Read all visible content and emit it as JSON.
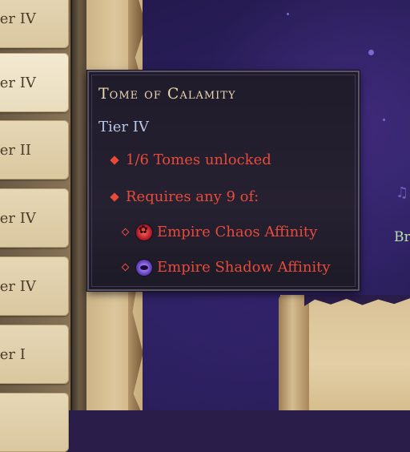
{
  "tier_list": [
    {
      "label": "Tier IV",
      "selected": false
    },
    {
      "label": "Tier IV",
      "selected": true
    },
    {
      "label": "Tier II",
      "selected": false
    },
    {
      "label": "Tier IV",
      "selected": false
    },
    {
      "label": "Tier IV",
      "selected": false
    },
    {
      "label": "Tier I",
      "selected": false
    }
  ],
  "background_text": "Br",
  "tooltip": {
    "title": "Tome of Calamity",
    "tier": "Tier IV",
    "unlocked": "1/6 Tomes unlocked",
    "requires": "Requires any 9 of:",
    "affinities": [
      {
        "label": "Empire Chaos Affinity",
        "icon": "chaos-affinity-icon"
      },
      {
        "label": "Empire Shadow Affinity",
        "icon": "shadow-affinity-icon"
      }
    ]
  },
  "colors": {
    "requirement_red": "#e84a3a",
    "title_gold": "#e8d6b0",
    "tier_blue": "#b8c8e8",
    "cosmos_purple": "#2a1d4a"
  }
}
